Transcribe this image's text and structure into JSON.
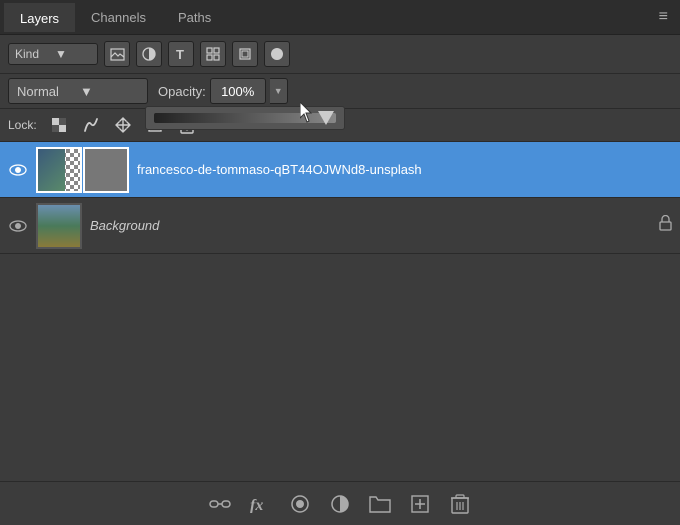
{
  "tabs": {
    "items": [
      {
        "label": "Layers",
        "id": "layers",
        "active": true
      },
      {
        "label": "Channels",
        "id": "channels",
        "active": false
      },
      {
        "label": "Paths",
        "id": "paths",
        "active": false
      }
    ]
  },
  "filter": {
    "kind_label": "Kind",
    "icons": [
      "image-icon",
      "circle-half-icon",
      "text-icon",
      "transform-icon",
      "adjustment-icon",
      "circle-icon"
    ]
  },
  "blend": {
    "mode_label": "Normal",
    "opacity_label": "Opacity:",
    "opacity_value": "100%"
  },
  "lock": {
    "label": "Lock:",
    "icons": [
      "lock-transparent-icon",
      "lock-paint-icon",
      "lock-move-icon",
      "lock-artboard-icon",
      "lock-all-icon"
    ]
  },
  "layers": [
    {
      "id": "layer1",
      "name": "francesco-de-tommaso-qBT44OJWNd8-unsplash",
      "visible": true,
      "selected": true,
      "has_mask": true,
      "italic": false
    },
    {
      "id": "layer2",
      "name": "Background",
      "visible": true,
      "selected": false,
      "has_mask": false,
      "italic": true,
      "locked": true
    }
  ],
  "bottom_toolbar": {
    "buttons": [
      {
        "id": "link",
        "label": "⛓",
        "title": "Link layers"
      },
      {
        "id": "fx",
        "label": "fx",
        "title": "Add layer style"
      },
      {
        "id": "mask",
        "label": "⬤",
        "title": "Add layer mask"
      },
      {
        "id": "adjustment",
        "label": "◑",
        "title": "New fill or adjustment layer"
      },
      {
        "id": "group",
        "label": "🗀",
        "title": "New group"
      },
      {
        "id": "new-layer",
        "label": "+",
        "title": "Create new layer"
      },
      {
        "id": "delete",
        "label": "🗑",
        "title": "Delete layer"
      }
    ]
  },
  "menu_icon": "≡"
}
